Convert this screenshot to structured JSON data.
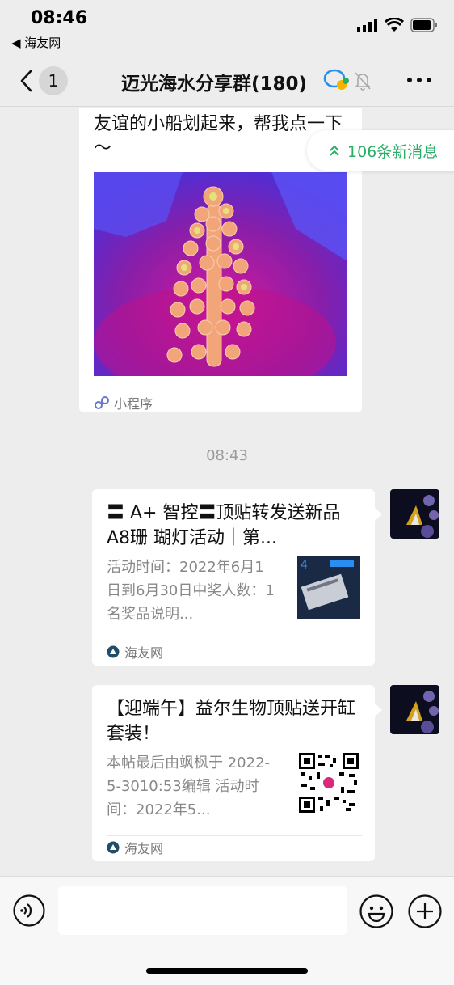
{
  "status_bar": {
    "time": "08:46",
    "back_app": "◀ 海友网"
  },
  "nav": {
    "unread_count": "1",
    "title": "迈光海水分享群(180)",
    "title_icon": "chat-bubbles-icon",
    "mute_icon": "muted-bell-icon",
    "more_icon": "more-dots-icon"
  },
  "new_messages": {
    "label": "106条新消息",
    "icon": "double-chevron-up-icon"
  },
  "mini_program_card": {
    "title": "友谊的小船划起来，帮我点一下～",
    "footer_label": "小程序",
    "footer_icon": "mini-program-icon"
  },
  "time_divider": "08:43",
  "messages": [
    {
      "title": "〓 A+ 智控〓顶贴转发送新品 A8珊 瑚灯活动｜第...",
      "description": "活动时间：2022年6月1日到6月30日中奖人数：1名奖品说明...",
      "source": "海友网"
    },
    {
      "title": "【迎端午】益尔生物顶贴送开缸套装！",
      "description": "本帖最后由飒枫于 2022-5-3010:53编辑 活动时间：2022年5...",
      "source": "海友网"
    }
  ],
  "input_bar": {
    "voice_icon": "voice-icon",
    "emoji_icon": "emoji-icon",
    "plus_icon": "plus-icon"
  },
  "colors": {
    "accent_green": "#2aae67",
    "background": "#ededed",
    "card": "#ffffff"
  }
}
